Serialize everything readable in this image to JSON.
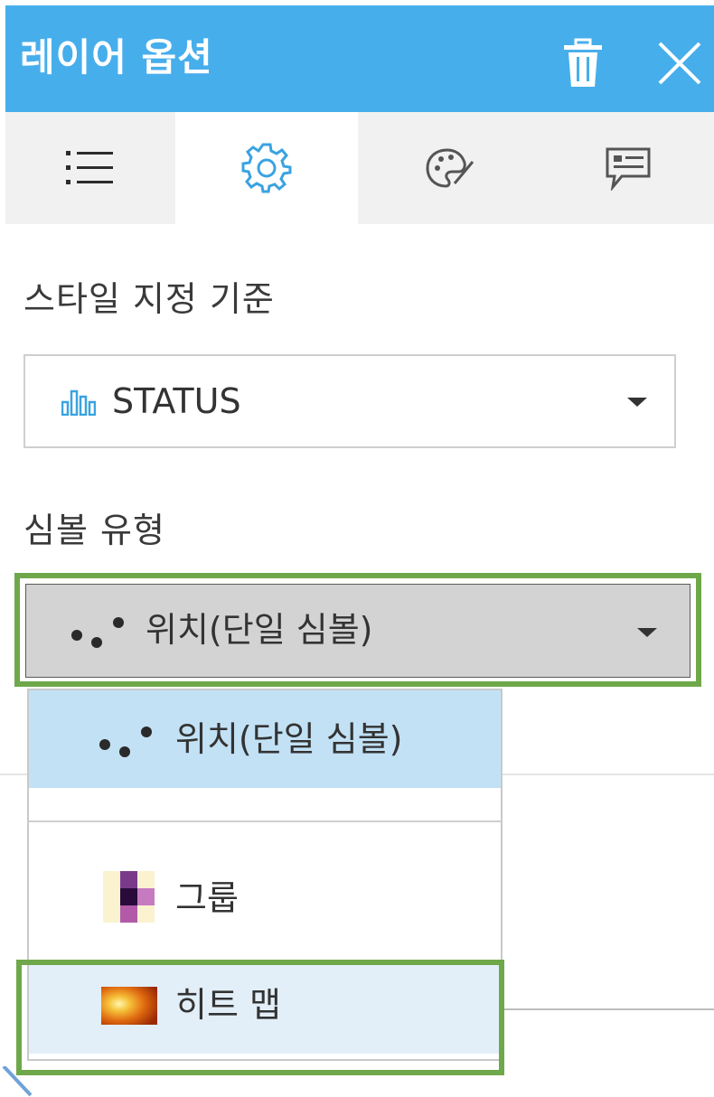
{
  "panel": {
    "title": "레이어 옵션",
    "header_color": "#47aeec",
    "actions": {
      "delete": "trash-icon",
      "close": "close-icon"
    }
  },
  "tabs": [
    {
      "icon": "list-icon",
      "active": false
    },
    {
      "icon": "gear-icon",
      "active": true
    },
    {
      "icon": "palette-icon",
      "active": false
    },
    {
      "icon": "popup-icon",
      "active": false
    }
  ],
  "style_by": {
    "label": "스타일 지정 기준",
    "value": "STATUS",
    "icon": "bar-chart-icon"
  },
  "symbol_type": {
    "label": "심볼 유형",
    "value": "위치(단일 심볼)",
    "icon": "dots-icon",
    "highlight_color": "#6fa84a"
  },
  "dropdown": {
    "options": [
      {
        "label": "위치(단일 심볼)",
        "icon": "dots-icon",
        "selected": true
      },
      {
        "label": "그룹",
        "icon": "grid-cluster-icon",
        "selected": false
      },
      {
        "label": "히트 맵",
        "icon": "heatmap-icon",
        "selected": false,
        "highlighted": true
      }
    ]
  }
}
